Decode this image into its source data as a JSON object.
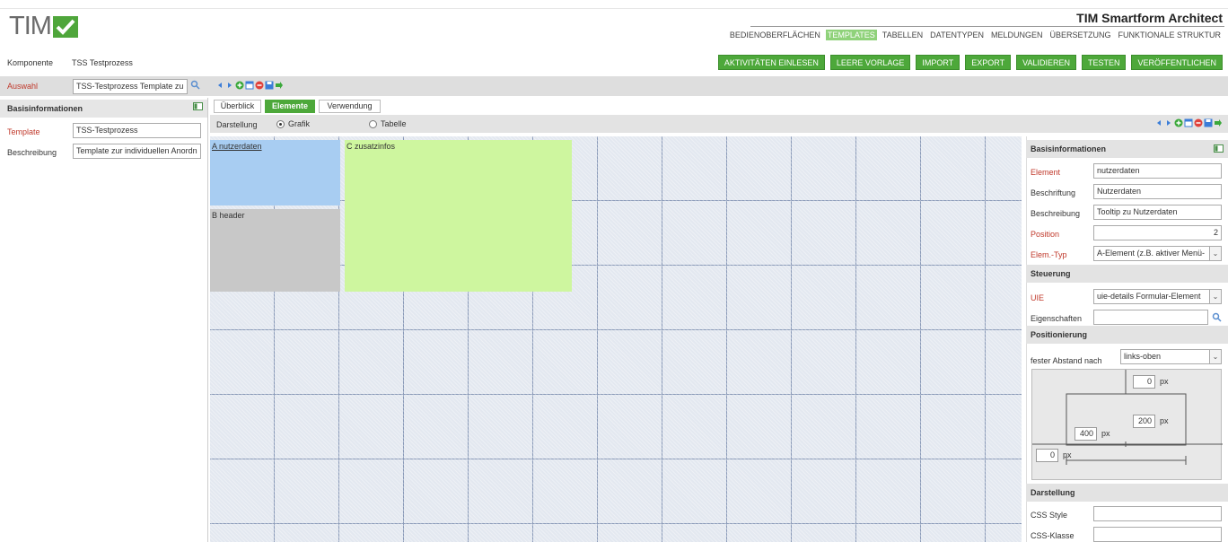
{
  "app": {
    "logo_text": "TIM",
    "title": "TIM Smartform Architect"
  },
  "main_nav": [
    {
      "label": "BEDIENOBERFLÄCHEN",
      "active": false
    },
    {
      "label": "TEMPLATES",
      "active": true
    },
    {
      "label": "TABELLEN",
      "active": false
    },
    {
      "label": "DATENTYPEN",
      "active": false
    },
    {
      "label": "MELDUNGEN",
      "active": false
    },
    {
      "label": "ÜBERSETZUNG",
      "active": false
    },
    {
      "label": "FUNKTIONALE STRUKTUR",
      "active": false
    }
  ],
  "komponente": {
    "label": "Komponente",
    "value": "TSS Testprozess"
  },
  "actions": [
    "AKTIVITÄTEN EINLESEN",
    "LEERE VORLAGE",
    "IMPORT",
    "EXPORT",
    "VALIDIEREN",
    "TESTEN",
    "VERÖFFENTLICHEN"
  ],
  "auswahl": {
    "label": "Auswahl",
    "value": "TSS-Testprozess Template zu"
  },
  "left_panel": {
    "title": "Basisinformationen",
    "template_label": "Template",
    "template_value": "TSS-Testprozess",
    "beschreibung_label": "Beschreibung",
    "beschreibung_value": "Template zur individuellen Anordn"
  },
  "tabs": [
    {
      "label": "Überblick",
      "active": false
    },
    {
      "label": "Elemente",
      "active": true
    },
    {
      "label": "Verwendung",
      "active": false
    }
  ],
  "darstellung": {
    "label": "Darstellung",
    "options": [
      {
        "label": "Grafik",
        "selected": true
      },
      {
        "label": "Tabelle",
        "selected": false
      }
    ]
  },
  "canvas_blocks": {
    "a": "A nutzerdaten",
    "b": "B header",
    "c": "C zusatzinfos"
  },
  "right_panel": {
    "basis_title": "Basisinformationen",
    "element_label": "Element",
    "element_value": "nutzerdaten",
    "beschriftung_label": "Beschriftung",
    "beschriftung_value": "Nutzerdaten",
    "beschreibung_label": "Beschreibung",
    "beschreibung_value": "Tooltip zu Nutzerdaten",
    "position_label": "Position",
    "position_value": "2",
    "elemtyp_label": "Elem.-Typ",
    "elemtyp_value": "A-Element (z.B. aktiver Menü-",
    "steuerung_title": "Steuerung",
    "uie_label": "UIE",
    "uie_value": "uie-details Formular-Element",
    "eigenschaften_label": "Eigenschaften",
    "eigenschaften_value": "",
    "positionierung_title": "Positionierung",
    "abstand_label": "fester Abstand nach",
    "abstand_value": "links-oben",
    "px_unit": "px",
    "top_value": "0",
    "height_value": "200",
    "width_value": "400",
    "left_value": "0",
    "darstellung_title": "Darstellung",
    "css_style_label": "CSS Style",
    "css_style_value": "",
    "css_klasse_label": "CSS-Klasse",
    "css_klasse_value": ""
  },
  "colors": {
    "brand_green": "#4da83a",
    "required_red": "#c0392b",
    "block_a": "#a8cdf2",
    "block_b": "#c8c8c8",
    "block_c": "#cef69f"
  }
}
